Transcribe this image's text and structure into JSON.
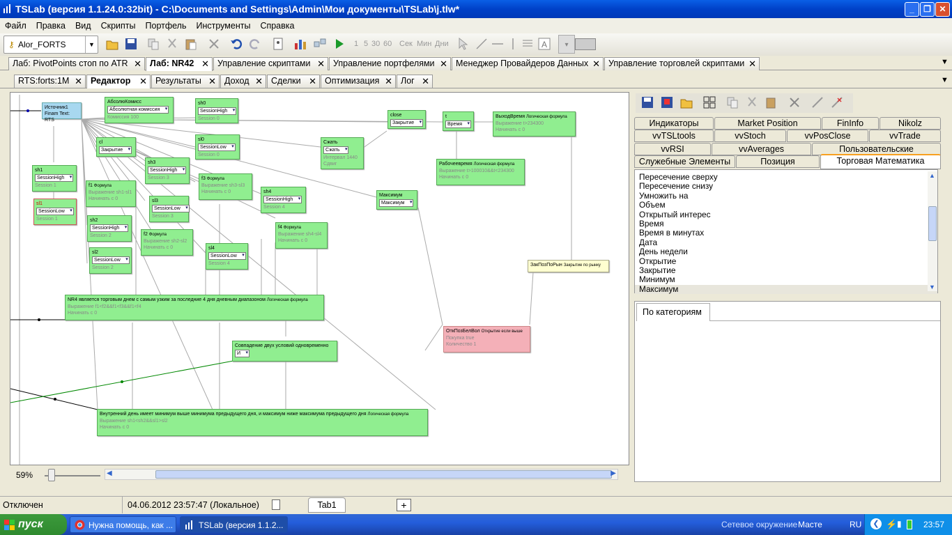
{
  "window": {
    "title": "TSLab (версия 1.1.24.0:32bit) - C:\\Documents and Settings\\Admin\\Мои документы\\TSLab\\j.tlw*"
  },
  "menu": [
    "Файл",
    "Правка",
    "Вид",
    "Скрипты",
    "Портфель",
    "Инструменты",
    "Справка"
  ],
  "toolbar": {
    "provider": "Alor_FORTS",
    "timeframes": [
      "1",
      "5",
      "30",
      "60"
    ],
    "periods": [
      "Сек",
      "Мин",
      "Дни"
    ]
  },
  "doc_tabs": [
    "Лаб: PivotPoints стоп по ATR",
    "Лаб: NR42",
    "Управление скриптами",
    "Управление портфелями",
    "Менеджер Провайдеров Данных",
    "Управление торговлей скриптами"
  ],
  "sub_tabs": [
    "RTS:forts:1M",
    "Редактор",
    "Результаты",
    "Доход",
    "Сделки",
    "Оптимизация",
    "Лог"
  ],
  "nodes": {
    "src": {
      "title": "Источник1",
      "sub": "Finam Text: RTS"
    },
    "abs": {
      "title": "АбсолюКомисс",
      "sel": "Абсолютная комиссия",
      "p": "Комиссия   100"
    },
    "sh0": {
      "title": "sh0",
      "sel": "SessionHigh",
      "p": "Session      0"
    },
    "close": {
      "title": "close",
      "sel": "Закрытие"
    },
    "t": {
      "title": "t",
      "sel": "Время"
    },
    "exit": {
      "title": "ВыходВремя",
      "kind": "Логическая формула",
      "p1": "Выражение t>234300",
      "p2": "Начинать с         0"
    },
    "cl": {
      "title": "cl",
      "sel": "Закрытие"
    },
    "sl0": {
      "title": "sl0",
      "sel": "SessionLow",
      "p": "Session      0"
    },
    "comp": {
      "title": "Сжать",
      "sel": "Сжать",
      "p1": "Интервал 1440",
      "p2": "Сдвиг"
    },
    "work": {
      "title": "Рабочеевремя",
      "kind": "Логическая формула",
      "p1": "Выражение t>100010&&t<234300",
      "p2": "Начинать с         0"
    },
    "sh1": {
      "title": "sh1",
      "sel": "SessionHigh",
      "p": "Session      1"
    },
    "sh3": {
      "title": "sh3",
      "sel": "SessionHigh",
      "p": "Session      3"
    },
    "f3": {
      "title": "f3",
      "kind": "Формула",
      "p1": "Выражение sh3-sl3",
      "p2": "Начинать с         0"
    },
    "f1": {
      "title": "f1",
      "kind": "Формула",
      "p1": "Выражение sh1-sl1",
      "p2": "Начинать с         0"
    },
    "sl1": {
      "title": "sl1",
      "sel": "SessionLow",
      "p": "Session      1"
    },
    "sl3": {
      "title": "sl3",
      "sel": "SessionLow",
      "p": "Session      3"
    },
    "sh4": {
      "title": "sh4",
      "sel": "SessionHigh",
      "p": "Session      4"
    },
    "max": {
      "title": "Максимум",
      "sel": "Максимум"
    },
    "sh2": {
      "title": "sh2",
      "sel": "SessionHigh",
      "p": "Session      2"
    },
    "f4": {
      "title": "f4",
      "kind": "Формула",
      "p1": "Выражение sh4-sl4",
      "p2": "Начинать с         0"
    },
    "f2": {
      "title": "f2",
      "kind": "Формула",
      "p1": "Выражение sh2-sl2",
      "p2": "Начинать с         0"
    },
    "sl2": {
      "title": "sl2",
      "sel": "SessionLow",
      "p": "Session      2"
    },
    "sl4": {
      "title": "sl4",
      "sel": "SessionLow",
      "p": "Session      4"
    },
    "zak": {
      "title": "ЗакПозПоРын",
      "kind": "Закрытие по рынку"
    },
    "nr4": {
      "title": "NR4 является торговым днем с самым узким за последние 4 дня дневным диапазоном",
      "kind": "Логическая формула",
      "p1": "Выражение f1<f2&&f1<f3&&f1<f4",
      "p2": "Начинать с         0"
    },
    "open": {
      "title": "ОткПозБелВол",
      "kind": "Открытие если выше",
      "p1": "Покупка        true",
      "p2": "Количество       1"
    },
    "and": {
      "title": "Совпадение двух условий одновременно",
      "sel": "И"
    },
    "inside": {
      "title": "Внутренний день имеет минимум выше минимума предыдущего дня, и максимум ниже максимума предыдущего дня",
      "kind": "Логическая формула",
      "p1": "Выражение sh1<sh2&&sl1>sl2",
      "p2": "Начинать с         0"
    }
  },
  "zoom": "59%",
  "right_tabs": {
    "row1": [
      "Индикаторы",
      "Market Position",
      "FinInfo",
      "Nikolz"
    ],
    "row2": [
      "vvTSLtools",
      "vvStoch",
      "vvPosClose",
      "vvTrade"
    ],
    "row3": [
      "vvRSI",
      "vvAverages",
      "Пользовательские"
    ],
    "row4": [
      "Служебные Элементы",
      "Позиция",
      "Торговая Математика"
    ]
  },
  "list": [
    "Пересечение сверху",
    "Пересечение снизу",
    "Умножить на",
    "Объем",
    "Открытый интерес",
    "Время",
    "Время в минутах",
    "Дата",
    "День недели",
    "Открытие",
    "Закрытие",
    "Минимум",
    "Максимум"
  ],
  "category_tab": "По категориям",
  "status": {
    "conn": "Отключен",
    "time": "04.06.2012 23:57:47 (Локальное)",
    "tab": "Tab1",
    "plus": "+"
  },
  "taskbar": {
    "start": "пуск",
    "tasks": [
      "Нужна помощь, как ...",
      "TSLab (версия 1.1.2..."
    ],
    "tray_text": "Сетевое окружение",
    "tray_master": "Масте",
    "lang": "RU",
    "clock": "23:57"
  }
}
